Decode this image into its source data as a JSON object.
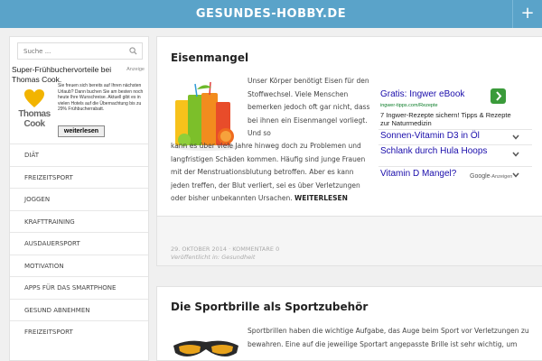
{
  "header": {
    "site_title": "GESUNDES-HOBBY.DE",
    "menu_button": "+"
  },
  "sidebar": {
    "search_placeholder": "Suche ...",
    "ad": {
      "title": "Super-Frühbuchervorteile bei Thomas Cook.",
      "tag": "Anzeige",
      "logo_text": "Thomas Cook",
      "body": "Sie freuen sich bereits auf Ihren nächsten Urlaub? Dann buchen Sie am besten noch heute Ihre Wunschreise. Aktuell gibt es in vielen Hotels auf die Übernachtung bis zu 29% Frühbucherrabatt.",
      "button": "weiterlesen"
    },
    "nav_items": [
      "DIÄT",
      "FREIZEITSPORT",
      "JOGGEN",
      "KRAFTTRAINING",
      "AUSDAUERSPORT",
      "MOTIVATION",
      "APPS FÜR DAS SMARTPHONE",
      "GESUND ABNEHMEN",
      "FREIZEITSPORT"
    ]
  },
  "post1": {
    "title": "Eisenmangel",
    "text_top": "Unser Körper benötigt Eisen für den Stoffwechsel. Viele Menschen bemerken jedoch oft gar nicht, dass bei ihnen ein Eisenmangel vorliegt. Und so",
    "text_bottom": "kann es über viele Jahre hinweg doch zu Problemen und langfristigen Schäden kommen. Häufig sind junge Frauen mit der Menstruationsblutung betroffen. Aber es kann jeden treffen, der Blut verliert, sei es über Verletzungen oder bisher unbekannten Ursachen.",
    "read_more": "WEITERLESEN",
    "meta_date": "29. OKTOBER 2014 · KOMMENTARE 0",
    "meta_cat_label": "Veröffentlicht in:",
    "meta_cat": "Gesundheit"
  },
  "ad2": {
    "ad1_headline": "Gratis: Ingwer eBook",
    "ad1_url": "ingwer-tipps.com/Rezepte",
    "ad1_desc": "7 Ingwer-Rezepte sichern! Tipps & Rezepte zur Naturmedizin",
    "ad2_headline": "Sonnen-Vitamin D3 in Öl",
    "ad3_headline": "Schlank durch Hula Hoops",
    "ad4_headline": "Vitamin D Mangel?",
    "google_label": "Google",
    "google_suffix": "-Anzeigen"
  },
  "post2": {
    "title": "Die Sportbrille als Sportzubehör",
    "text": "Sportbrillen haben die wichtige Aufgabe, das Auge beim Sport vor Verletzungen zu bewahren. Eine auf die jeweilige Sportart angepasste Brille ist sehr wichtig, um"
  },
  "colors": {
    "header": "#5aa3c9",
    "ad_link": "#1a0dab",
    "ad_url": "#0a7c27",
    "ad_button": "#3a9b3a"
  }
}
